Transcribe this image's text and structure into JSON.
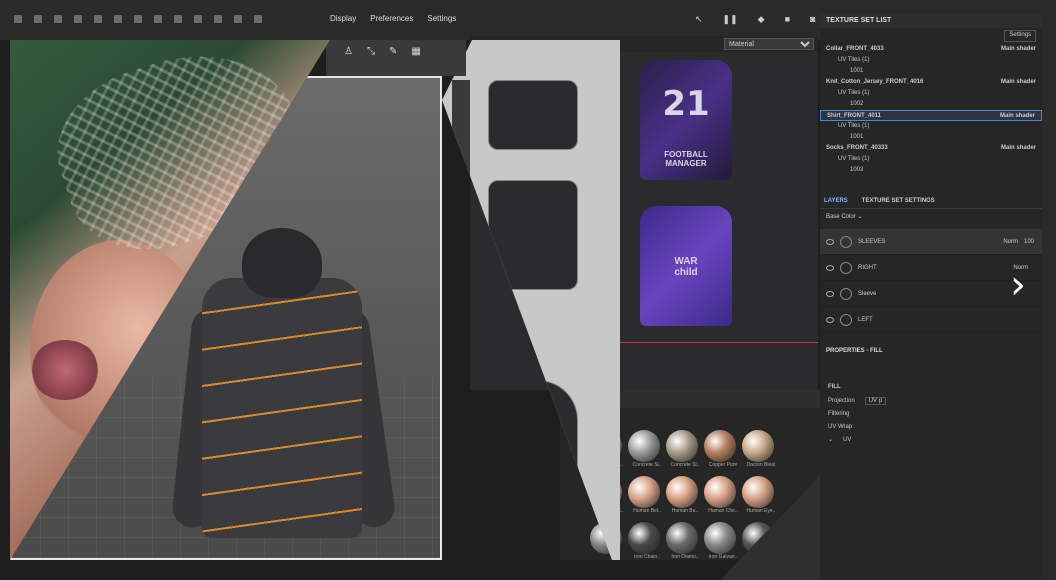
{
  "menu": {
    "display": "Display",
    "preferences": "Preferences",
    "settings": "Settings"
  },
  "texture_view": {
    "material_select": "Material"
  },
  "jerseys": [
    {
      "number": "21",
      "brand_line1": "FOOTBALL",
      "brand_line2": "MANAGER"
    },
    {
      "number": "",
      "brand_line1": "WAR",
      "brand_line2": "child"
    }
  ],
  "shelf": {
    "materials": [
      "Concrete S..",
      "Concrete Si..",
      "Concrete Si..",
      "Copper Pure",
      "Dacron Bleat",
      "Human Bac..",
      "Human Bel..",
      "Human Bu..",
      "Human Che..",
      "Human Eye..",
      "",
      "Iron Chain..",
      "Iron Diamo..",
      "Iron Galvan..",
      ""
    ]
  },
  "texture_set_list": {
    "title": "TEXTURE SET LIST",
    "settings_label": "Settings",
    "rows": [
      {
        "text": "Collar_FRONT_4033",
        "shader": "Main shader",
        "level": 0
      },
      {
        "text": "UV Tiles (1)",
        "shader": "",
        "level": 1
      },
      {
        "text": "1001",
        "shader": "",
        "level": 2
      },
      {
        "text": "Knit_Cotton_Jersey_FRONT_4016",
        "shader": "Main shader",
        "level": 0
      },
      {
        "text": "UV Tiles (1)",
        "shader": "",
        "level": 1
      },
      {
        "text": "1002",
        "shader": "",
        "level": 2
      },
      {
        "text": "Shirt_FRONT_4011",
        "shader": "Main shader",
        "level": 0
      },
      {
        "text": "UV Tiles (1)",
        "shader": "",
        "level": 1
      },
      {
        "text": "1001",
        "shader": "",
        "level": 2
      },
      {
        "text": "Socks_FRONT_40333",
        "shader": "Main shader",
        "level": 0
      },
      {
        "text": "UV Tiles (1)",
        "shader": "",
        "level": 1
      },
      {
        "text": "1003",
        "shader": "",
        "level": 2
      }
    ]
  },
  "layers": {
    "tab_layers": "LAYERS",
    "tab_tss": "TEXTURE SET SETTINGS",
    "channel": "Base Color",
    "items": [
      {
        "name": "SLEEVES",
        "blend": "Norm",
        "opacity": "100"
      },
      {
        "name": "RIGHT",
        "blend": "Norm",
        "opacity": ""
      },
      {
        "name": "Sleeve",
        "blend": "",
        "opacity": ""
      },
      {
        "name": "LEFT",
        "blend": "",
        "opacity": ""
      }
    ]
  },
  "properties": {
    "title": "PROPERTIES - FILL",
    "section": "FILL",
    "projection_label": "Projection",
    "projection_value": "UV p",
    "filtering_label": "Filtering",
    "uvwrap_label": "UV Wrap",
    "uv_label": "UV"
  },
  "colors": {
    "accent": "#4a8ad4",
    "stripe": "#d98a2d",
    "trim": "#b8d234"
  }
}
